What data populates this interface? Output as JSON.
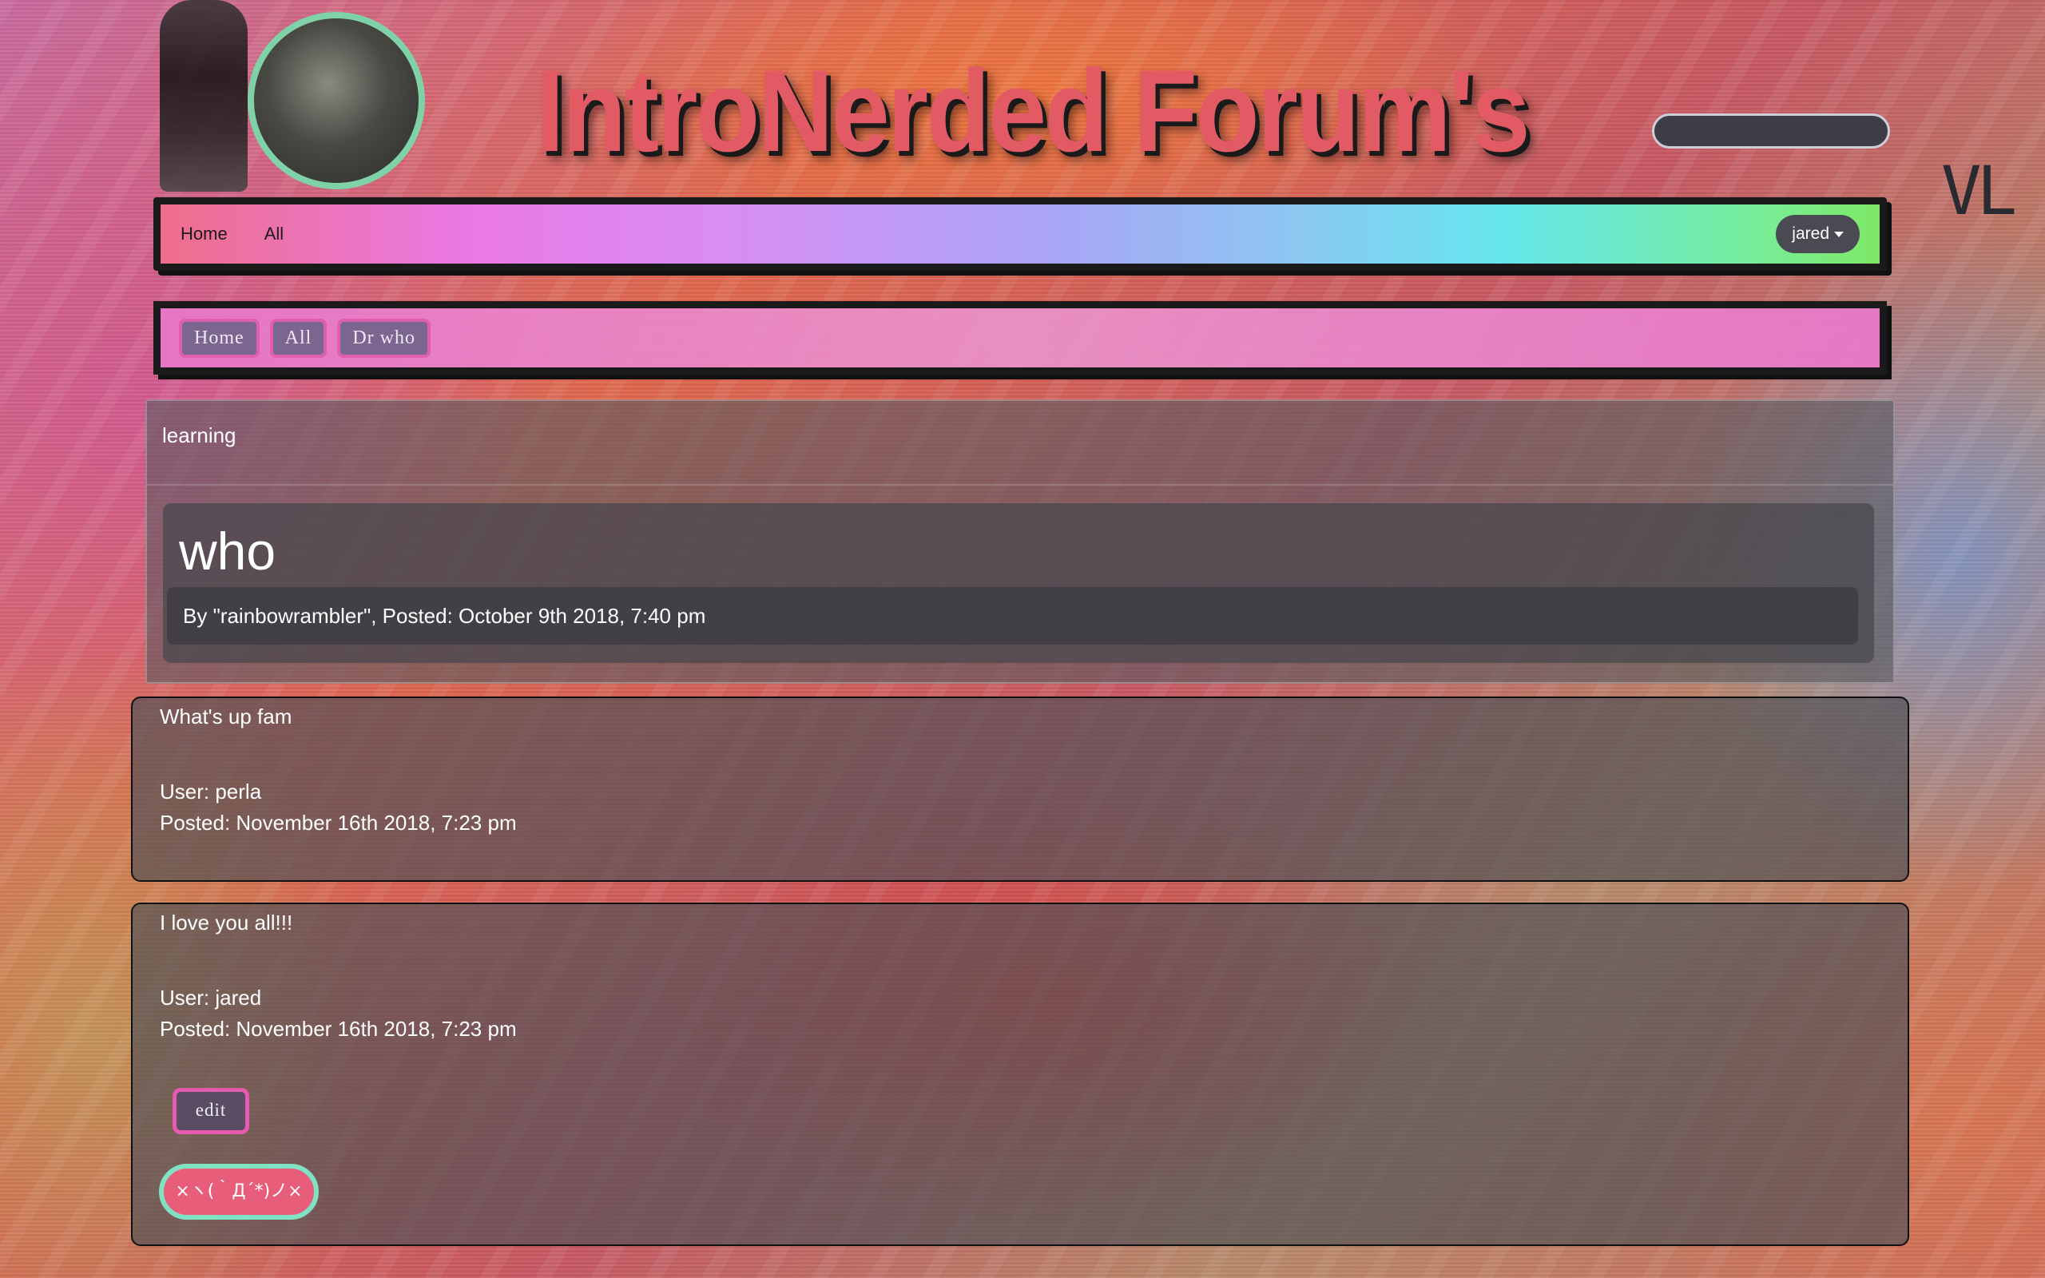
{
  "header": {
    "site_title": "IntroNerded Forum's",
    "side_logo": "VL",
    "search_placeholder": ""
  },
  "navbar": {
    "links": [
      "Home",
      "All"
    ],
    "user_dropdown_label": "jared"
  },
  "breadcrumb": {
    "items": [
      "Home",
      "All",
      "Dr who"
    ]
  },
  "post": {
    "category": "learning",
    "title": "who",
    "meta": "By \"rainbowrambler\", Posted: October 9th 2018, 7:40 pm"
  },
  "comments": [
    {
      "text": "What's up fam",
      "user": "User: perla",
      "posted": "Posted: November 16th 2018, 7:23 pm"
    },
    {
      "text": "I love you all!!!",
      "user": "User: jared",
      "posted": "Posted: November 16th 2018, 7:23 pm",
      "edit_label": "edit",
      "delete_label": "×ヽ(｀Д´*)ノ×"
    }
  ],
  "colors": {
    "title": "#e25a63",
    "avatar_ring": "#7fd1a8",
    "crumb_border": "#df5fae",
    "delete_button": "#e85d7a",
    "delete_border": "#7fe3c3"
  },
  "icons": [
    "caret-down-icon"
  ]
}
